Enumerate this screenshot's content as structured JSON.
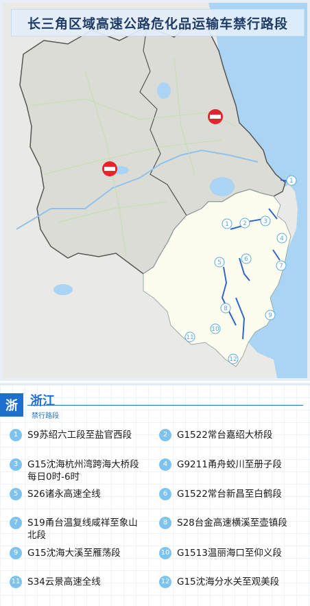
{
  "title": "长三角区域高速公路危化品运输车禁行路段",
  "province": {
    "badge": "浙",
    "name": "浙江",
    "subtitle": "禁行路段"
  },
  "colors": {
    "accent": "#1e6fd0",
    "marker": "#7ec3ee",
    "restricted_road": "#2f66c7",
    "no_entry": "#e3262e",
    "zhejiang_fill": "#fdfdf0",
    "other_fill": "#e7e7e2",
    "sea": "#a7d3f3"
  },
  "map": {
    "icons": [
      "no-entry-sign",
      "no-entry-sign"
    ],
    "markers": [
      "1",
      "1",
      "2",
      "3",
      "4",
      "5",
      "6",
      "7",
      "8",
      "9",
      "10",
      "11",
      "12"
    ]
  },
  "sections": [
    {
      "num": "1",
      "text": "S9苏绍六工段至盐官西段"
    },
    {
      "num": "2",
      "text": "G1522常台嘉绍大桥段"
    },
    {
      "num": "3",
      "text": "G15沈海杭州湾跨海大桥段\n每日0时-6时"
    },
    {
      "num": "4",
      "text": "G9211甬舟蛟川至册子段"
    },
    {
      "num": "5",
      "text": "S26诸永高速全线"
    },
    {
      "num": "6",
      "text": "G1522常台新昌至白鹤段"
    },
    {
      "num": "7",
      "text": "S19甬台温复线咸祥至象山\n北段"
    },
    {
      "num": "8",
      "text": "S28台金高速横溪至壶镇段"
    },
    {
      "num": "9",
      "text": "G15沈海大溪至雁荡段"
    },
    {
      "num": "10",
      "text": "G1513温丽海口至仰义段"
    },
    {
      "num": "11",
      "text": "S34云景高速全线"
    },
    {
      "num": "12",
      "text": "G15沈海分水关至观美段"
    }
  ]
}
